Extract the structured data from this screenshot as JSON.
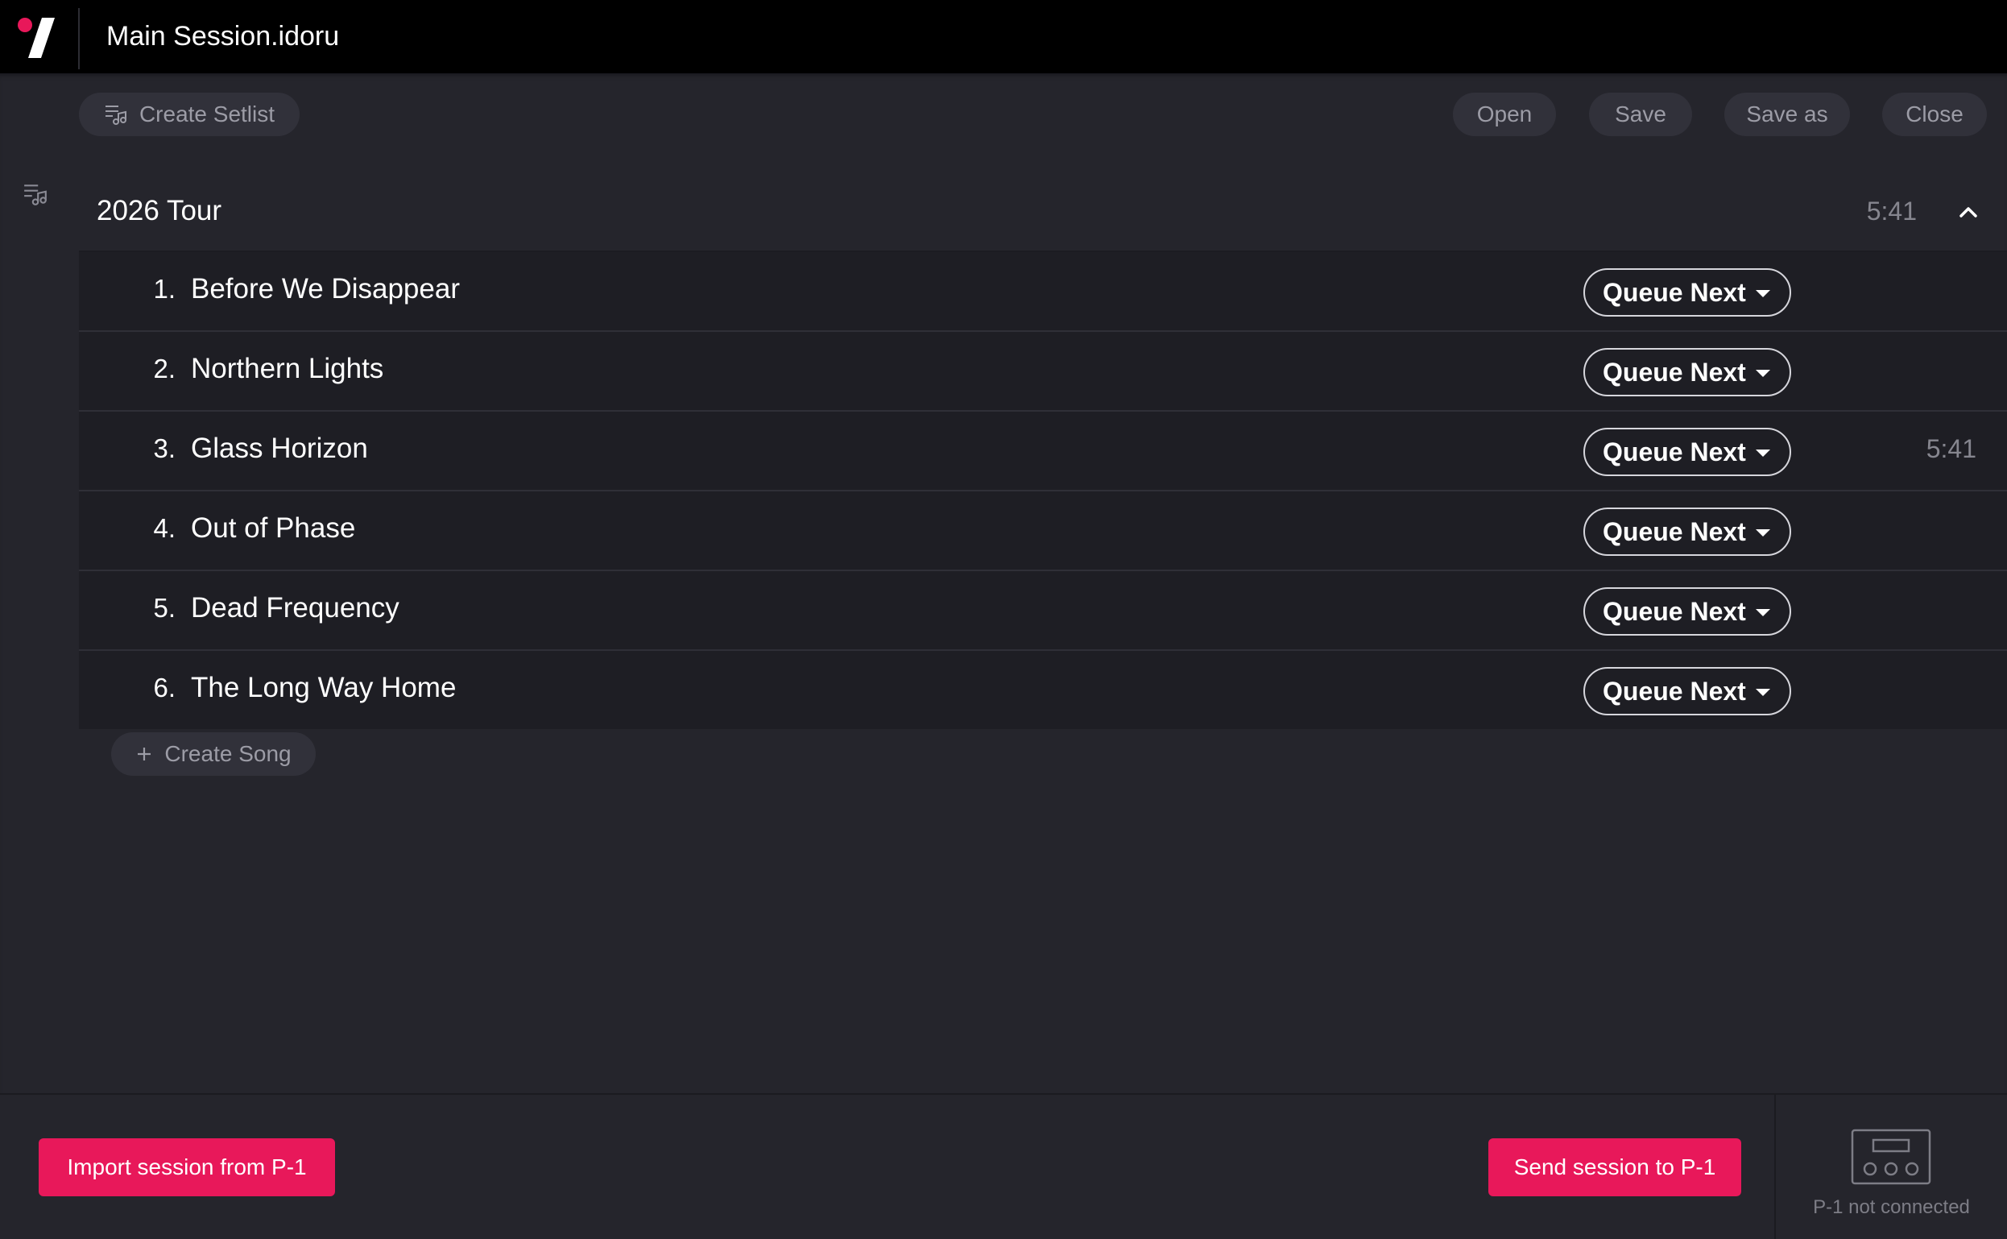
{
  "app": {
    "title": "Main Session.idoru"
  },
  "toolbar": {
    "create_setlist": "Create Setlist",
    "open": "Open",
    "save": "Save",
    "save_as": "Save as",
    "close": "Close"
  },
  "setlist": {
    "name": "2026 Tour",
    "total_duration": "5:41",
    "songs": [
      {
        "number": "1.",
        "title": "Before We Disappear",
        "action": "Queue Next",
        "duration": ""
      },
      {
        "number": "2.",
        "title": "Northern Lights",
        "action": "Queue Next",
        "duration": ""
      },
      {
        "number": "3.",
        "title": "Glass Horizon",
        "action": "Queue Next",
        "duration": "5:41"
      },
      {
        "number": "4.",
        "title": "Out of Phase",
        "action": "Queue Next",
        "duration": ""
      },
      {
        "number": "5.",
        "title": "Dead Frequency",
        "action": "Queue Next",
        "duration": ""
      },
      {
        "number": "6.",
        "title": "The Long Way Home",
        "action": "Queue Next",
        "duration": ""
      }
    ],
    "create_song": "Create Song"
  },
  "footer": {
    "import_label": "Import session from P-1",
    "send_label": "Send session to P-1",
    "device_status": "P-1 not connected"
  },
  "colors": {
    "accent": "#e8185a",
    "background": "#25252c",
    "row_background": "#1e1e24",
    "titlebar": "#000000"
  },
  "icons": {
    "logo": "idoru-logo",
    "setlist": "playlist-music-icon",
    "collapse": "chevron-up-icon",
    "plus": "plus-icon",
    "dropdown": "caret-down-icon",
    "device": "p1-device-icon"
  }
}
